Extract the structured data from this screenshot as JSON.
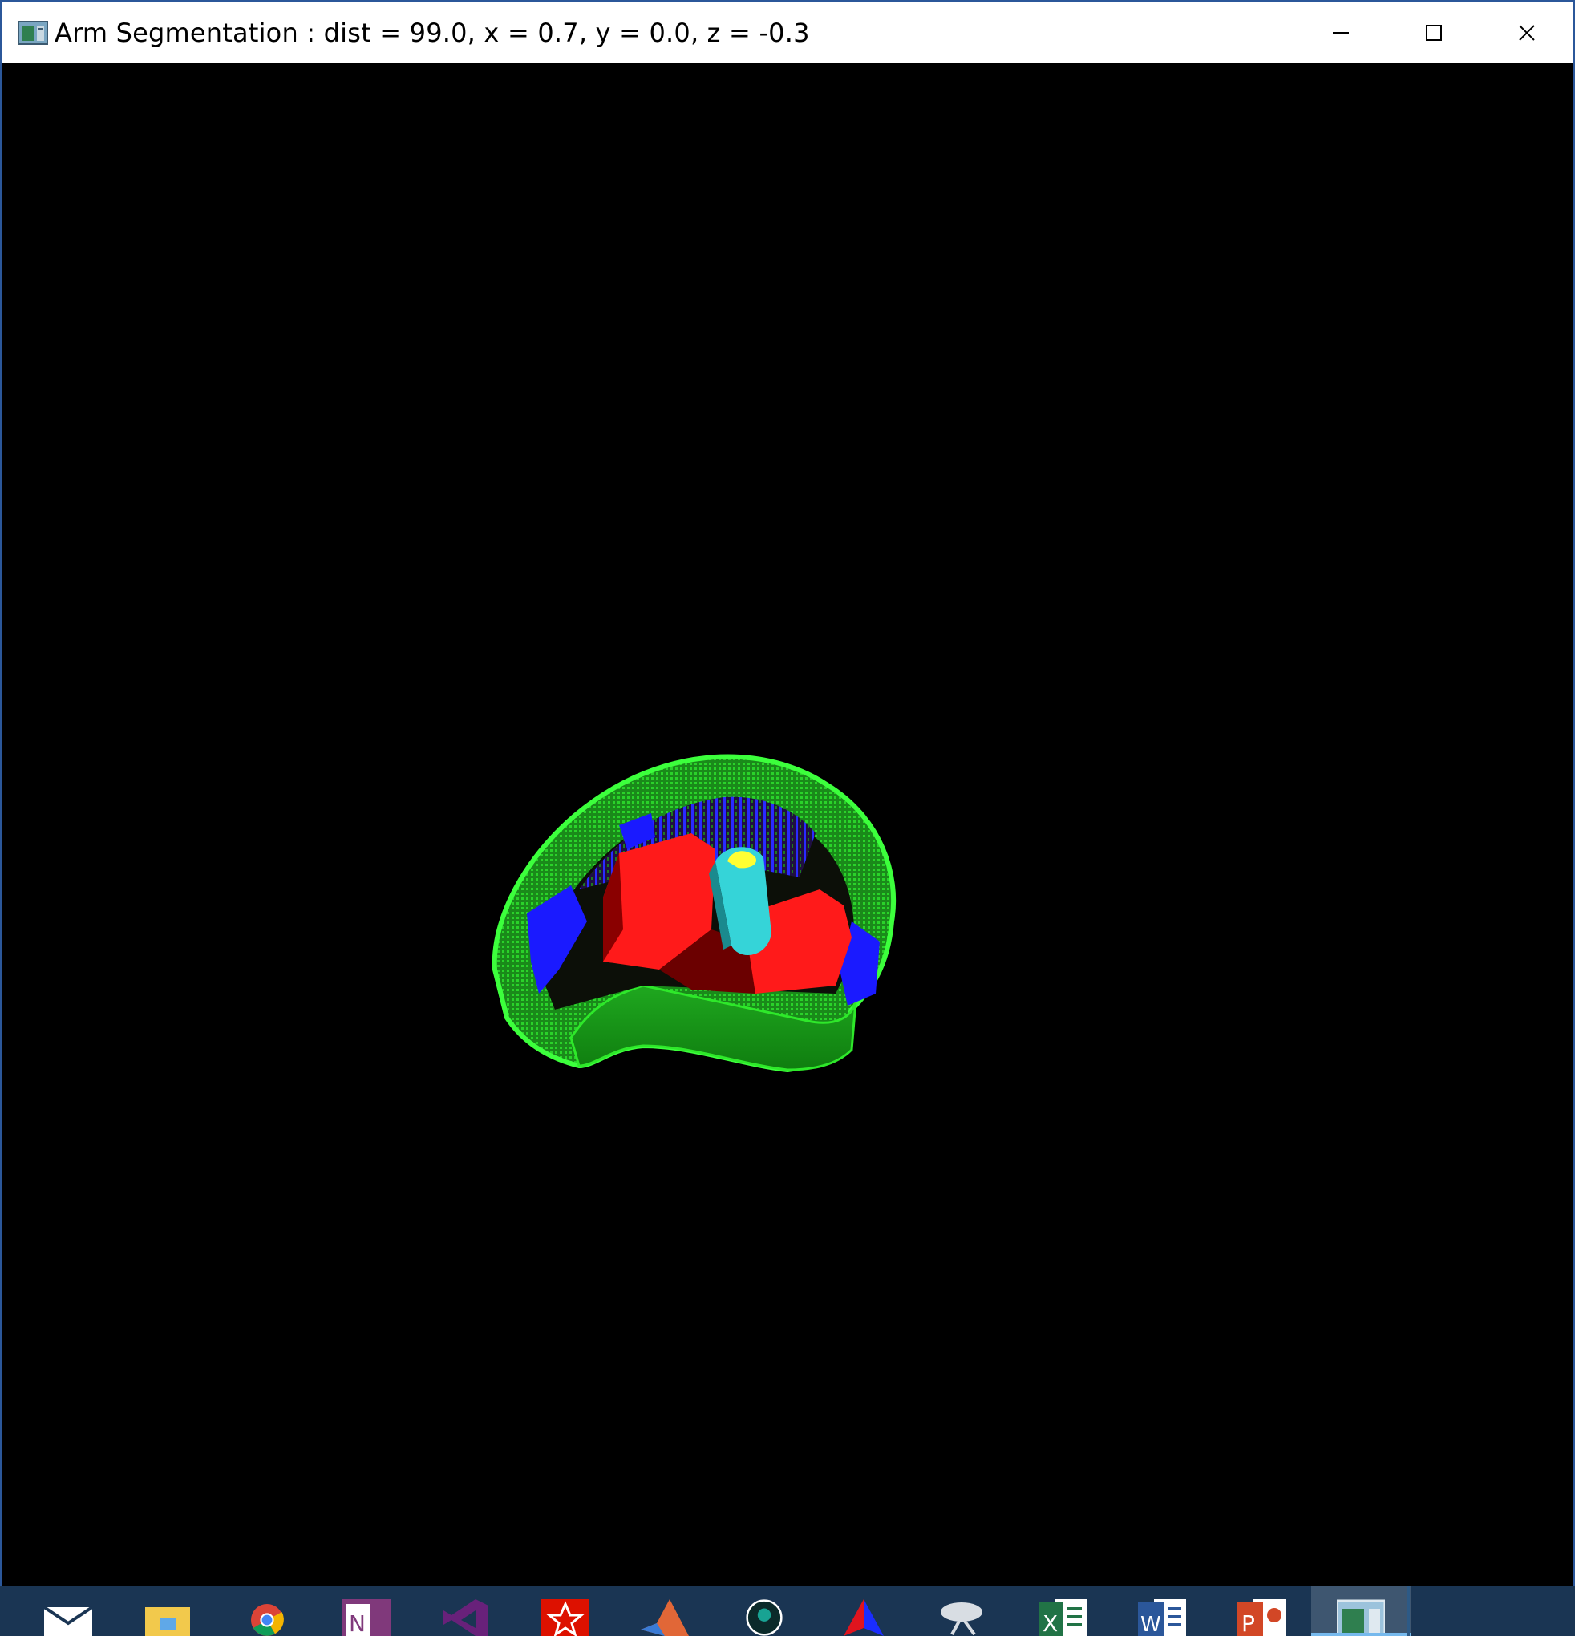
{
  "window": {
    "title": "Arm Segmentation : dist = 99.0, x = 0.7, y = 0.0, z = -0.3",
    "controls": {
      "minimize": "minimize-icon",
      "maximize": "maximize-icon",
      "close": "close-icon"
    }
  },
  "viewport": {
    "background": "#000000",
    "segment_colors": {
      "outer_tissue": "#2ee82a",
      "muscle": "#ff1a1a",
      "fat": "#1a1aff",
      "bone": "#35d4d8",
      "marrow": "#ffff33"
    }
  },
  "taskbar": {
    "background": "#1a3553",
    "items": [
      {
        "icon": "mail-icon"
      },
      {
        "icon": "file-explorer-icon"
      },
      {
        "icon": "chrome-icon"
      },
      {
        "icon": "onenote-icon"
      },
      {
        "icon": "visual-studio-icon"
      },
      {
        "icon": "wolfram-mathematica-icon"
      },
      {
        "icon": "matlab-icon"
      },
      {
        "icon": "gitkraken-icon"
      },
      {
        "icon": "vector-app-icon"
      },
      {
        "icon": "satellite-dish-icon"
      },
      {
        "icon": "excel-icon"
      },
      {
        "icon": "word-icon"
      },
      {
        "icon": "powerpoint-icon"
      },
      {
        "icon": "arm-segmentation-app-icon",
        "active": true
      }
    ]
  }
}
